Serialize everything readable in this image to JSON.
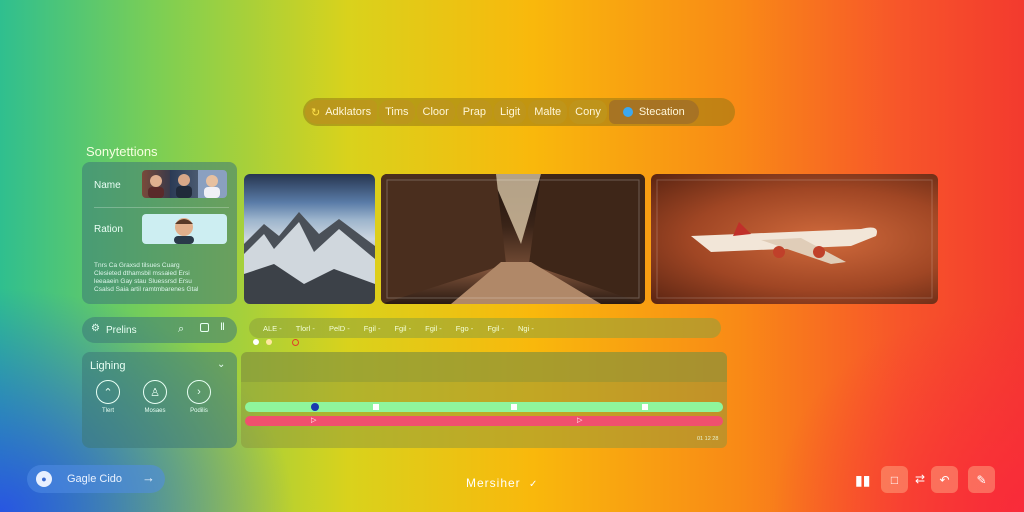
{
  "toolbar": {
    "items": [
      "Adklators",
      "Tims",
      "Cloor",
      "Prap",
      "Ligit",
      "Malte",
      "Cony",
      "Stecation"
    ]
  },
  "section_title": "Sonytettions",
  "people_panel": {
    "name_label": "Name",
    "ration_label": "Ration",
    "notes": "Tnrs Ca Graxsd tilsues Cuarg\nClesieted dthamsbil mssaied Ersi\nleeaaein Gay stau Sluessrsd Ersu\nCsalsd Saia artil ramtmbarenes Gtal"
  },
  "preset_bar": {
    "label": "Prelins"
  },
  "timeline": {
    "labels": [
      "ALE -",
      "Tlorl -",
      "PelD -",
      "Fgil -",
      "Fgil -",
      "Fgil -",
      "Fgo -",
      "Fgil -",
      "Ngi -"
    ]
  },
  "lighting": {
    "title": "Lighing",
    "buttons": [
      "Tlert",
      "Mosaes",
      "Podilis"
    ]
  },
  "track_panel": {
    "timecode": "01 12 28"
  },
  "brand": {
    "label": "Gagle Cido"
  },
  "footer": {
    "title": "Mersiher"
  },
  "colors": {
    "track_green": "#8ff59c",
    "track_pink": "#f0506e",
    "accent_blue": "#3ca8f0"
  }
}
